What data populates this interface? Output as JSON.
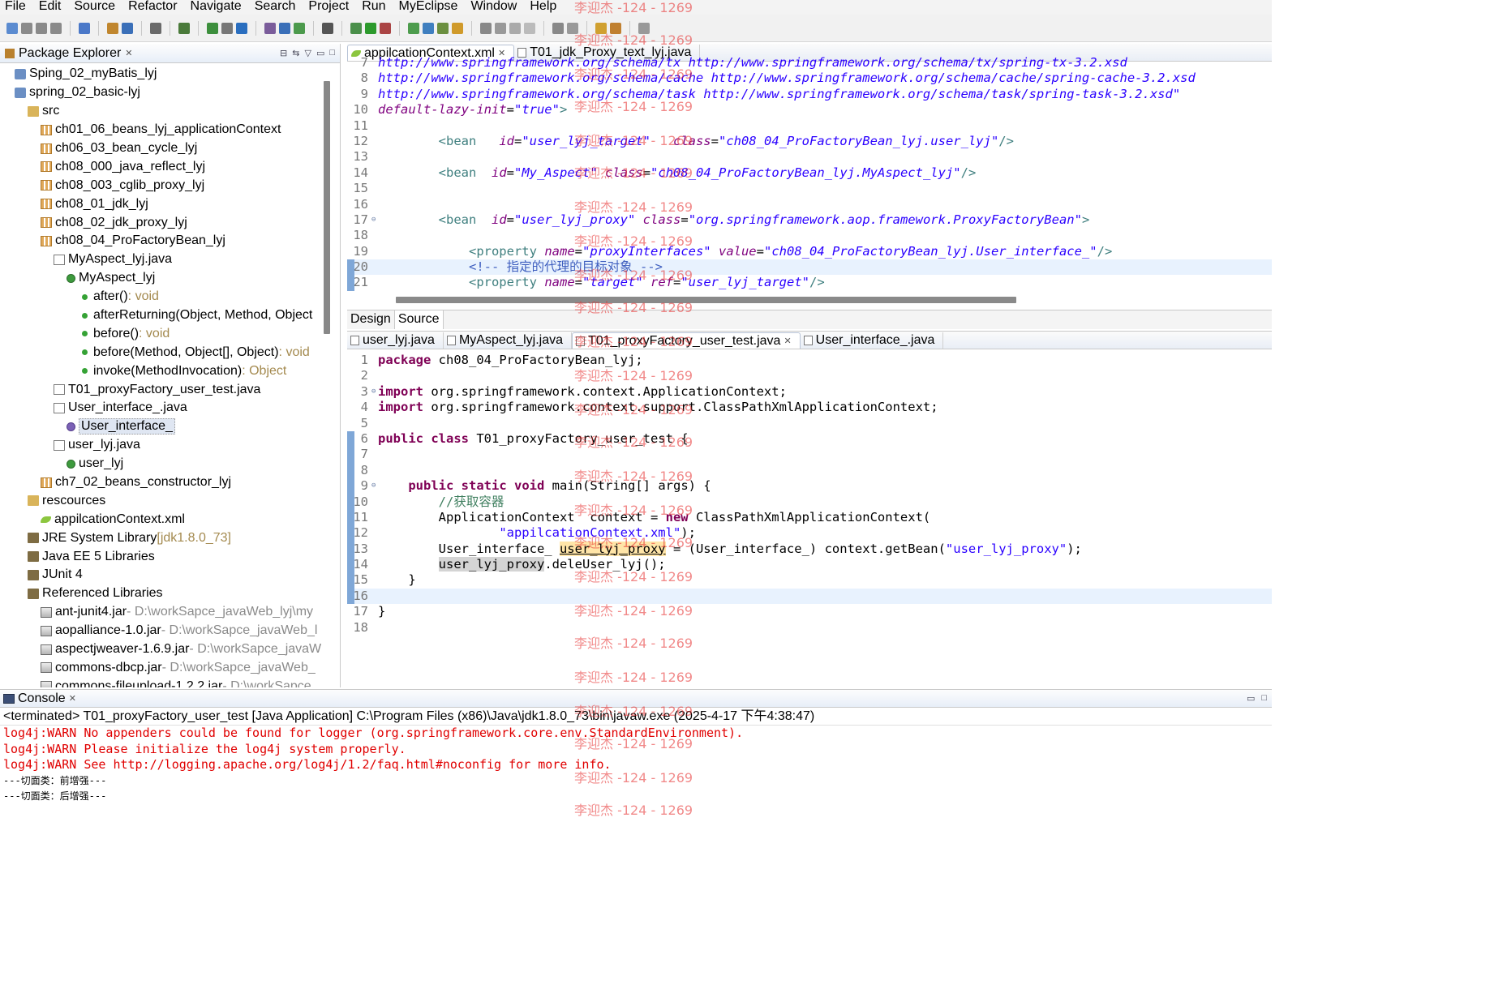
{
  "menu": [
    "File",
    "Edit",
    "Source",
    "Refactor",
    "Navigate",
    "Search",
    "Project",
    "Run",
    "MyEclipse",
    "Window",
    "Help"
  ],
  "explorer": {
    "title": "Package Explorer",
    "tree": [
      {
        "depth": 1,
        "icon": "proj",
        "label": "Sping_02_myBatis_lyj"
      },
      {
        "depth": 1,
        "icon": "proj",
        "label": "spring_02_basic-lyj"
      },
      {
        "depth": 2,
        "icon": "folder",
        "label": "src"
      },
      {
        "depth": 3,
        "icon": "pkg",
        "label": "ch01_06_beans_lyj_applicationContext"
      },
      {
        "depth": 3,
        "icon": "pkg",
        "label": "ch06_03_bean_cycle_lyj"
      },
      {
        "depth": 3,
        "icon": "pkg",
        "label": "ch08_000_java_reflect_lyj"
      },
      {
        "depth": 3,
        "icon": "pkg",
        "label": "ch08_003_cglib_proxy_lyj"
      },
      {
        "depth": 3,
        "icon": "pkg",
        "label": "ch08_01_jdk_lyj"
      },
      {
        "depth": 3,
        "icon": "pkg",
        "label": "ch08_02_jdk_proxy_lyj"
      },
      {
        "depth": 3,
        "icon": "pkg",
        "label": "ch08_04_ProFactoryBean_lyj"
      },
      {
        "depth": 4,
        "icon": "jfile",
        "label": "MyAspect_lyj.java"
      },
      {
        "depth": 5,
        "icon": "cls",
        "label": "MyAspect_lyj"
      },
      {
        "depth": 6,
        "icon": "meth",
        "label": "after()",
        "suffix": " : void"
      },
      {
        "depth": 6,
        "icon": "meth",
        "label": "afterReturning(Object, Method, Object",
        "suffix": ""
      },
      {
        "depth": 6,
        "icon": "meth",
        "label": "before()",
        "suffix": " : void"
      },
      {
        "depth": 6,
        "icon": "meth",
        "label": "before(Method, Object[], Object)",
        "suffix": " : void"
      },
      {
        "depth": 6,
        "icon": "meth",
        "label": "invoke(MethodInvocation)",
        "suffix": " : Object"
      },
      {
        "depth": 4,
        "icon": "jfile",
        "label": "T01_proxyFactory_user_test.java"
      },
      {
        "depth": 4,
        "icon": "jfile",
        "label": "User_interface_.java"
      },
      {
        "depth": 5,
        "icon": "intf",
        "label": "User_interface_",
        "selected": true
      },
      {
        "depth": 4,
        "icon": "jfile",
        "label": "user_lyj.java"
      },
      {
        "depth": 5,
        "icon": "cls",
        "label": "user_lyj"
      },
      {
        "depth": 3,
        "icon": "pkg",
        "label": "ch7_02_beans_constructor_lyj"
      },
      {
        "depth": 2,
        "icon": "folder",
        "label": "rescources"
      },
      {
        "depth": 3,
        "icon": "xml",
        "label": "appilcationContext.xml"
      },
      {
        "depth": 2,
        "icon": "lib",
        "label": "JRE System Library",
        "suffix": " [jdk1.8.0_73]"
      },
      {
        "depth": 2,
        "icon": "lib",
        "label": "Java EE 5 Libraries"
      },
      {
        "depth": 2,
        "icon": "lib",
        "label": "JUnit 4"
      },
      {
        "depth": 2,
        "icon": "lib",
        "label": "Referenced Libraries"
      },
      {
        "depth": 3,
        "icon": "jar",
        "label": "ant-junit4.jar",
        "path": " - D:\\workSapce_javaWeb_lyj\\my"
      },
      {
        "depth": 3,
        "icon": "jar",
        "label": "aopalliance-1.0.jar",
        "path": " - D:\\workSapce_javaWeb_l"
      },
      {
        "depth": 3,
        "icon": "jar",
        "label": "aspectjweaver-1.6.9.jar",
        "path": " - D:\\workSapce_javaW"
      },
      {
        "depth": 3,
        "icon": "jar",
        "label": "commons-dbcp.jar",
        "path": " - D:\\workSapce_javaWeb_"
      },
      {
        "depth": 3,
        "icon": "jar",
        "label": "commons-fileupload-1.2.2.jar",
        "path": " - D:\\workSapce"
      }
    ]
  },
  "xml_editor": {
    "tabs": [
      {
        "label": "appilcationContext.xml",
        "icon": "xml",
        "active": true,
        "closable": true
      },
      {
        "label": "T01_jdk_Proxy_text_lyj.java",
        "icon": "java",
        "active": false,
        "closable": false
      }
    ],
    "lines": [
      {
        "n": "7",
        "html": "<span class='xml-url'>http://www.springframework.org/schema/tx http://www.springframework.org/schema/tx/spring-tx-3.2.xsd</span>"
      },
      {
        "n": "8",
        "html": "<span class='xml-url'>http://www.springframework.org/schema/cache http://www.springframework.org/schema/cache/spring-cache-3.2.xsd</span>"
      },
      {
        "n": "9",
        "html": "<span class='xml-url'>http://www.springframework.org/schema/task http://www.springframework.org/schema/task/spring-task-3.2.xsd\"</span>"
      },
      {
        "n": "10",
        "html": "<span class='xml-attr'>default-lazy-init</span>=<span class='xml-str'>\"true\"</span><span class='xml-tag'>&gt;</span>"
      },
      {
        "n": "11",
        "html": ""
      },
      {
        "n": "12",
        "html": "        <span class='xml-tag'>&lt;bean</span>   <span class='xml-attr'>id</span>=<span class='xml-str'>\"user_lyj_target\"</span>   <span class='xml-attr'>class</span>=<span class='xml-str'>\"ch08_04_ProFactoryBean_lyj.user_lyj\"</span><span class='xml-tag'>/&gt;</span>"
      },
      {
        "n": "13",
        "html": ""
      },
      {
        "n": "14",
        "html": "        <span class='xml-tag'>&lt;bean</span>  <span class='xml-attr'>id</span>=<span class='xml-str'>\"My_Aspect\"</span> <span class='xml-attr'>class</span>=<span class='xml-str'>\"ch08_04_ProFactoryBean_lyj.MyAspect_lyj\"</span><span class='xml-tag'>/&gt;</span>"
      },
      {
        "n": "15",
        "html": ""
      },
      {
        "n": "16",
        "html": ""
      },
      {
        "n": "17",
        "html": "        <span class='xml-tag'>&lt;bean</span>  <span class='xml-attr'>id</span>=<span class='xml-str'>\"user_lyj_proxy\"</span> <span class='xml-attr'>class</span>=<span class='xml-str'>\"org.springframework.aop.framework.ProxyFactoryBean\"</span><span class='xml-tag'>&gt;</span>",
        "fold": true
      },
      {
        "n": "18",
        "html": ""
      },
      {
        "n": "19",
        "html": "            <span class='xml-tag'>&lt;property</span> <span class='xml-attr'>name</span>=<span class='xml-str'>\"proxyInterfaces\"</span> <span class='xml-attr'>value</span>=<span class='xml-str'>\"ch08_04_ProFactoryBean_lyj.User_interface_\"</span><span class='xml-tag'>/&gt;</span>"
      },
      {
        "n": "20",
        "html": "            <span class='xml-cmt'>&lt;!-- 指定的代理的目标对象 --&gt;</span>",
        "cursor": true
      },
      {
        "n": "21",
        "html": "            <span class='xml-tag'>&lt;property</span> <span class='xml-attr'>name</span>=<span class='xml-str'>\"target\"</span> <span class='xml-attr'>ref</span>=<span class='xml-str'>\"user_lyj_target\"</span><span class='xml-tag'>/&gt;</span>"
      }
    ],
    "bottom_tabs": [
      "Design",
      "Source"
    ]
  },
  "java_editor": {
    "tabs": [
      {
        "label": "user_lyj.java",
        "active": false,
        "closable": false
      },
      {
        "label": "MyAspect_lyj.java",
        "active": false,
        "closable": false
      },
      {
        "label": "T01_proxyFactory_user_test.java",
        "active": true,
        "closable": true
      },
      {
        "label": "User_interface_.java",
        "active": false,
        "closable": false
      }
    ],
    "lines": [
      {
        "n": "1",
        "html": "<span class='kw'>package</span> ch08_04_ProFactoryBean_lyj;"
      },
      {
        "n": "2",
        "html": ""
      },
      {
        "n": "3",
        "html": "<span class='kw'>import</span> org.springframework.context.ApplicationContext;",
        "fold": true
      },
      {
        "n": "4",
        "html": "<span class='kw'>import</span> org.springframework.context.support.ClassPathXmlApplicationContext;"
      },
      {
        "n": "5",
        "html": ""
      },
      {
        "n": "6",
        "html": "<span class='kw'>public</span> <span class='kw'>class</span> T01_proxyFactory_user_test {"
      },
      {
        "n": "7",
        "html": ""
      },
      {
        "n": "8",
        "html": ""
      },
      {
        "n": "9",
        "html": "    <span class='kw'>public</span> <span class='kw'>static</span> <span class='kw'>void</span> main(String[] args) {",
        "fold": true
      },
      {
        "n": "10",
        "html": "        <span class='cmt'>//获取容器</span>"
      },
      {
        "n": "11",
        "html": "        ApplicationContext  context = <span class='kw'>new</span> ClassPathXmlApplicationContext("
      },
      {
        "n": "12",
        "html": "                <span class='str'>\"appilcationContext.xml\"</span>);"
      },
      {
        "n": "13",
        "html": "        User_interface_ <span class='occ'>user_lyj_proxy</span> = (User_interface_) context.getBean(<span class='str'>\"user_lyj_proxy\"</span>);"
      },
      {
        "n": "14",
        "html": "        <span class='occ2'>user_lyj_proxy</span>.deleUser_lyj();"
      },
      {
        "n": "15",
        "html": "    }"
      },
      {
        "n": "16",
        "html": "",
        "cursor": true
      },
      {
        "n": "17",
        "html": "}"
      },
      {
        "n": "18",
        "html": ""
      }
    ]
  },
  "console": {
    "title": "Console",
    "status": "<terminated> T01_proxyFactory_user_test [Java Application] C:\\Program Files (x86)\\Java\\jdk1.8.0_73\\bin\\javaw.exe (2025-4-17 下午4:38:47)",
    "lines": [
      {
        "text": "log4j:WARN No appenders could be found for logger (org.springframework.core.env.StandardEnvironment).",
        "kind": "err"
      },
      {
        "text": "log4j:WARN Please initialize the log4j system properly.",
        "kind": "err"
      },
      {
        "text": "log4j:WARN See http://logging.apache.org/log4j/1.2/faq.html#noconfig for more info.",
        "kind": "err"
      },
      {
        "text": "---切面类：前增强---",
        "kind": "out"
      },
      {
        "text": "---切面类：后增强---",
        "kind": "out"
      }
    ]
  },
  "watermark": "李迎杰 -124 - 1269",
  "colors": {
    "keyword": "#7f0055",
    "string": "#2a00ff",
    "comment": "#3f7f5f",
    "error": "#e00000",
    "watermark": "#e62828"
  }
}
